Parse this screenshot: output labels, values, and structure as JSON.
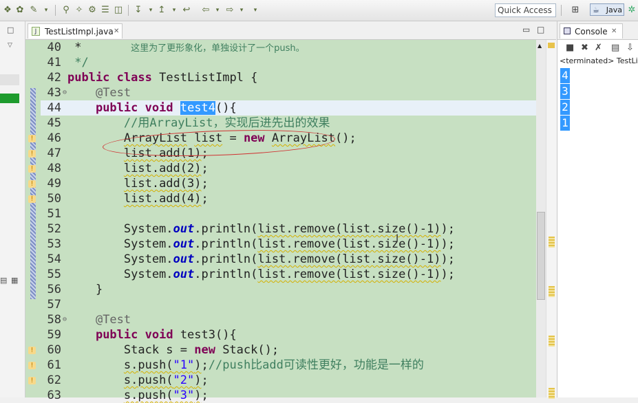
{
  "toolbar": {
    "quick_access": "Quick Access",
    "perspective": "Java"
  },
  "editor": {
    "tab": {
      "filename": "TestListImpl.java",
      "close": "✕"
    },
    "lines": [
      {
        "n": "40",
        "code": [
          {
            "t": " *       "
          },
          {
            "t": "这里为了更形象化，单独设计了一个push。",
            "c": "cm cjk"
          }
        ]
      },
      {
        "n": "41",
        "code": [
          {
            "t": " */",
            "c": "cm"
          }
        ]
      },
      {
        "n": "42",
        "code": [
          {
            "t": "public",
            "c": "kw"
          },
          {
            "t": " "
          },
          {
            "t": "class",
            "c": "kw"
          },
          {
            "t": " TestListImpl {"
          }
        ]
      },
      {
        "n": "43",
        "fold": "⊖",
        "code": [
          {
            "t": "    "
          },
          {
            "t": "@Test",
            "c": "ann"
          }
        ]
      },
      {
        "n": "44",
        "highlight": true,
        "code": [
          {
            "t": "    "
          },
          {
            "t": "public",
            "c": "kw"
          },
          {
            "t": " "
          },
          {
            "t": "void",
            "c": "kw"
          },
          {
            "t": " "
          },
          {
            "t": "test4",
            "c": "sel"
          },
          {
            "t": "(){"
          }
        ]
      },
      {
        "n": "45",
        "code": [
          {
            "t": "        "
          },
          {
            "t": "//用ArrayList，实现后进先出的效果",
            "c": "cm"
          }
        ]
      },
      {
        "n": "46",
        "warn": true,
        "code": [
          {
            "t": "        "
          },
          {
            "t": "ArrayList",
            "c": "wavy"
          },
          {
            "t": " "
          },
          {
            "t": "list",
            "c": "wavy"
          },
          {
            "t": " = "
          },
          {
            "t": "new",
            "c": "kw"
          },
          {
            "t": " "
          },
          {
            "t": "ArrayList",
            "c": "wavy"
          },
          {
            "t": "();"
          }
        ]
      },
      {
        "n": "47",
        "warn": true,
        "code": [
          {
            "t": "        "
          },
          {
            "t": "list.add(1)",
            "c": "wavy"
          },
          {
            "t": ";"
          }
        ]
      },
      {
        "n": "48",
        "warn": true,
        "code": [
          {
            "t": "        "
          },
          {
            "t": "list.add(2)",
            "c": "wavy"
          },
          {
            "t": ";"
          }
        ]
      },
      {
        "n": "49",
        "warn": true,
        "code": [
          {
            "t": "        "
          },
          {
            "t": "list.add(3)",
            "c": "wavy"
          },
          {
            "t": ";"
          }
        ]
      },
      {
        "n": "50",
        "warn": true,
        "code": [
          {
            "t": "        "
          },
          {
            "t": "list.add(4)",
            "c": "wavy"
          },
          {
            "t": ";"
          }
        ]
      },
      {
        "n": "51",
        "code": [
          {
            "t": ""
          }
        ]
      },
      {
        "n": "52",
        "code": [
          {
            "t": "        System."
          },
          {
            "t": "out",
            "c": "fld"
          },
          {
            "t": ".println("
          },
          {
            "t": "list.remove(list.size()-1)",
            "c": "wavy"
          },
          {
            "t": ");"
          }
        ]
      },
      {
        "n": "53",
        "code": [
          {
            "t": "        System."
          },
          {
            "t": "out",
            "c": "fld"
          },
          {
            "t": ".println("
          },
          {
            "t": "list.remove(list.size()-1)",
            "c": "wavy"
          },
          {
            "t": ");"
          }
        ]
      },
      {
        "n": "54",
        "code": [
          {
            "t": "        System."
          },
          {
            "t": "out",
            "c": "fld"
          },
          {
            "t": ".println("
          },
          {
            "t": "list.remove(list.size()-1)",
            "c": "wavy"
          },
          {
            "t": ");"
          }
        ]
      },
      {
        "n": "55",
        "code": [
          {
            "t": "        System."
          },
          {
            "t": "out",
            "c": "fld"
          },
          {
            "t": ".println("
          },
          {
            "t": "list.remove(list.size()-1)",
            "c": "wavy"
          },
          {
            "t": ");"
          }
        ]
      },
      {
        "n": "56",
        "code": [
          {
            "t": "    }"
          }
        ]
      },
      {
        "n": "57",
        "code": [
          {
            "t": ""
          }
        ]
      },
      {
        "n": "58",
        "fold": "⊖",
        "code": [
          {
            "t": "    "
          },
          {
            "t": "@Test",
            "c": "ann"
          }
        ]
      },
      {
        "n": "59",
        "code": [
          {
            "t": "    "
          },
          {
            "t": "public",
            "c": "kw"
          },
          {
            "t": " "
          },
          {
            "t": "void",
            "c": "kw"
          },
          {
            "t": " test3(){"
          }
        ]
      },
      {
        "n": "60",
        "warn": true,
        "code": [
          {
            "t": "        Stack s = "
          },
          {
            "t": "new",
            "c": "kw"
          },
          {
            "t": " Stack();"
          }
        ]
      },
      {
        "n": "61",
        "warn": true,
        "code": [
          {
            "t": "        "
          },
          {
            "t": "s.push(",
            "c": "wavy"
          },
          {
            "t": "\"1\"",
            "c": "str wavy"
          },
          {
            "t": ")",
            "c": "wavy"
          },
          {
            "t": ";"
          },
          {
            "t": "//push比add可读性更好，功能是一样的",
            "c": "cm"
          }
        ]
      },
      {
        "n": "62",
        "warn": true,
        "code": [
          {
            "t": "        "
          },
          {
            "t": "s.push(",
            "c": "wavy"
          },
          {
            "t": "\"2\"",
            "c": "str wavy"
          },
          {
            "t": ")",
            "c": "wavy"
          },
          {
            "t": ";"
          }
        ]
      },
      {
        "n": "63",
        "code": [
          {
            "t": "        "
          },
          {
            "t": "s.push(",
            "c": "wavy"
          },
          {
            "t": "\"3\"",
            "c": "str wavy"
          },
          {
            "t": ")",
            "c": "wavy"
          },
          {
            "t": ";"
          }
        ]
      }
    ]
  },
  "console": {
    "tab_label": "Console",
    "close": "✕",
    "status": "<terminated> TestListImpl",
    "output": [
      "4",
      "3",
      "2",
      "1"
    ]
  },
  "icons": [
    "perspective-icon",
    "java-icon",
    "console-icon",
    "terminate-icon",
    "remove-icon",
    "warning-icon",
    "fold-icon",
    "text-cursor-icon"
  ]
}
